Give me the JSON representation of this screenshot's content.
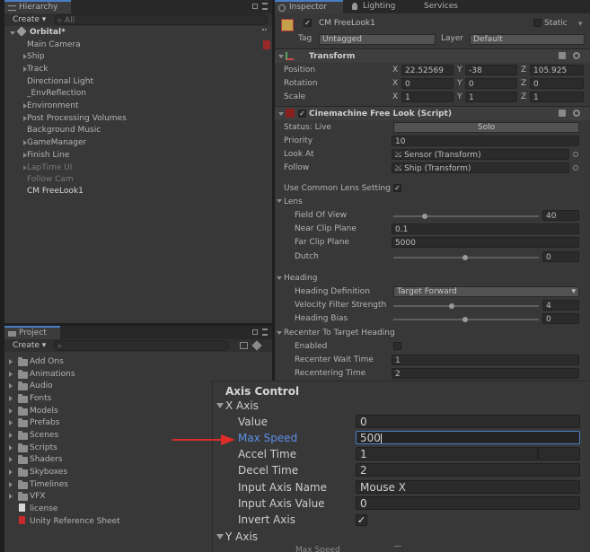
{
  "hierarchy": {
    "tab": "Hierarchy",
    "create": "Create",
    "search_placeholder": "All",
    "scene": "Orbital*",
    "items": [
      "Main Camera",
      "Ship",
      "Track",
      "Directional Light",
      "_EnvReflection",
      "Environment",
      "Post Processing Volumes",
      "Background Music",
      "GameManager",
      "Finish Line",
      "LapTime UI",
      "Follow Cam",
      "CM FreeLook1"
    ]
  },
  "project": {
    "tab": "Project",
    "create": "Create",
    "items": [
      "Add Ons",
      "Animations",
      "Audio",
      "Fonts",
      "Models",
      "Prefabs",
      "Scenes",
      "Scripts",
      "Shaders",
      "Skyboxes",
      "Timelines",
      "VFX",
      "license",
      "Unity Reference Sheet"
    ]
  },
  "inspector": {
    "tabs": [
      "Inspector",
      "Lighting",
      "Services"
    ],
    "object_name": "CM FreeLook1",
    "static_label": "Static",
    "tag_label": "Tag",
    "tag_value": "Untagged",
    "layer_label": "Layer",
    "layer_value": "Default",
    "transform": {
      "title": "Transform",
      "position_label": "Position",
      "px": "22.52569",
      "py": "-38",
      "pz": "105.925",
      "rotation_label": "Rotation",
      "rx": "0",
      "ry": "0",
      "rz": "0",
      "scale_label": "Scale",
      "sx": "1",
      "sy": "1",
      "sz": "1",
      "x": "X",
      "y": "Y",
      "z": "Z"
    },
    "cinemachine": {
      "title": "Cinemachine Free Look (Script)",
      "status_label": "Status: Live",
      "solo_label": "Solo",
      "priority_label": "Priority",
      "priority_value": "10",
      "lookat_label": "Look At",
      "lookat_value": "Sensor (Transform)",
      "follow_label": "Follow",
      "follow_value": "Ship (Transform)",
      "lens_settings_label": "Use Common Lens Setting",
      "lens_label": "Lens",
      "fov_label": "Field Of View",
      "fov_value": "40",
      "near_label": "Near Clip Plane",
      "near_value": "0.1",
      "far_label": "Far Clip Plane",
      "far_value": "5000",
      "dutch_label": "Dutch",
      "dutch_value": "0",
      "heading_label": "Heading",
      "heading_def_label": "Heading Definition",
      "heading_def_value": "Target Forward",
      "velocity_label": "Velocity Filter Strength",
      "velocity_value": "4",
      "bias_label": "Heading Bias",
      "bias_value": "0",
      "recenter_label": "Recenter To Target Heading",
      "enabled_label": "Enabled",
      "wait_label": "Recenter Wait Time",
      "wait_value": "1",
      "recentering_label": "Recentering Time",
      "recentering_value": "2"
    }
  },
  "axis_control": {
    "title": "Axis Control",
    "x_axis": "X Axis",
    "value_label": "Value",
    "value_value": "0",
    "max_speed_label": "Max Speed",
    "max_speed_value": "500",
    "accel_label": "Accel Time",
    "accel_value": "1",
    "decel_label": "Decel Time",
    "decel_value": "2",
    "input_name_label": "Input Axis Name",
    "input_name_value": "Mouse X",
    "input_value_label": "Input Axis Value",
    "input_value_value": "0",
    "invert_label": "Invert Axis",
    "y_axis": "Y Axis",
    "cut_label": "Max Speed"
  },
  "colors": {
    "accent": "#4a7ec4",
    "highlight_label": "#5b8fe8",
    "arrow": "#e02b2b"
  }
}
